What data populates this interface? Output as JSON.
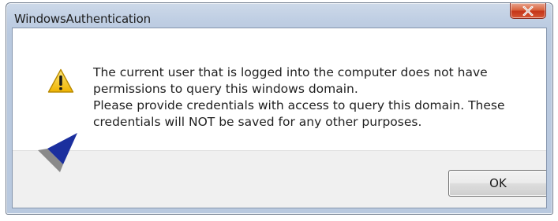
{
  "window": {
    "title": "WindowsAuthentication"
  },
  "icons": {
    "close": "close-icon",
    "warning": "warning-icon",
    "logo": "logo-icon"
  },
  "message": {
    "lines": [
      "The current user that is logged into the computer does not have",
      "permissions to query this windows domain.",
      "Please provide credentials with access to query this domain. These",
      "credentials will NOT be saved for any other purposes."
    ]
  },
  "buttons": {
    "ok_label": "OK"
  },
  "colors": {
    "close_button_red": "#c5351a",
    "warning_yellow": "#f5c518",
    "logo_blue": "#1b2f9e",
    "logo_gray": "#8a8a8a",
    "footer_gray": "#f0f0f0"
  }
}
